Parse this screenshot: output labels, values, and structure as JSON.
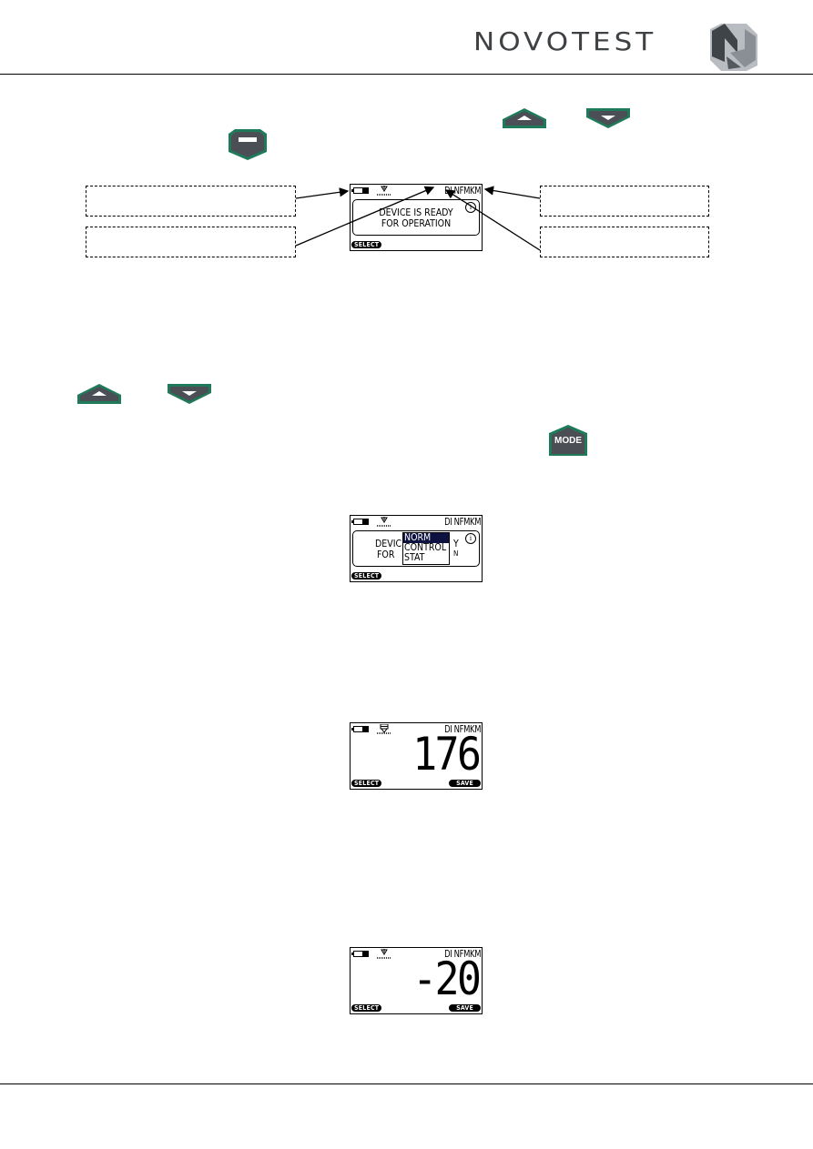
{
  "header": {
    "brand": "NOVOTEST",
    "logo_icon": "novotest-n-logo-icon"
  },
  "buttons": {
    "up_icon": "arrow-up-key-icon",
    "down_icon": "arrow-down-key-icon",
    "enter_icon": "enter-key-icon",
    "mode_label": "MODE",
    "colors": {
      "green": "#1f7a5a",
      "gray": "#4b4f55"
    }
  },
  "screen1": {
    "modes": "DI  NFMKM",
    "message_line1": "DEVICE IS READY",
    "message_line2": "FOR OPERATION",
    "info": "i",
    "softkey_left": "SELECT"
  },
  "screen2": {
    "modes": "DI  NFMKM",
    "bg_line1": "DEVIC",
    "bg_line2": "FOR",
    "bg_right1": "Y",
    "bg_right2": "N",
    "info": "i",
    "menu": [
      {
        "label": "NORM",
        "selected": true
      },
      {
        "label": "CONTROL",
        "selected": false
      },
      {
        "label": "STAT",
        "selected": false
      }
    ],
    "softkey_left": "SELECT"
  },
  "screen3": {
    "modes": "DI  NFMKM",
    "reading": "176",
    "softkey_left": "SELECT",
    "softkey_right": "SAVE"
  },
  "screen4": {
    "modes": "DI  NFMKM",
    "reading": "-20",
    "softkey_left": "SELECT",
    "softkey_right": "SAVE"
  }
}
